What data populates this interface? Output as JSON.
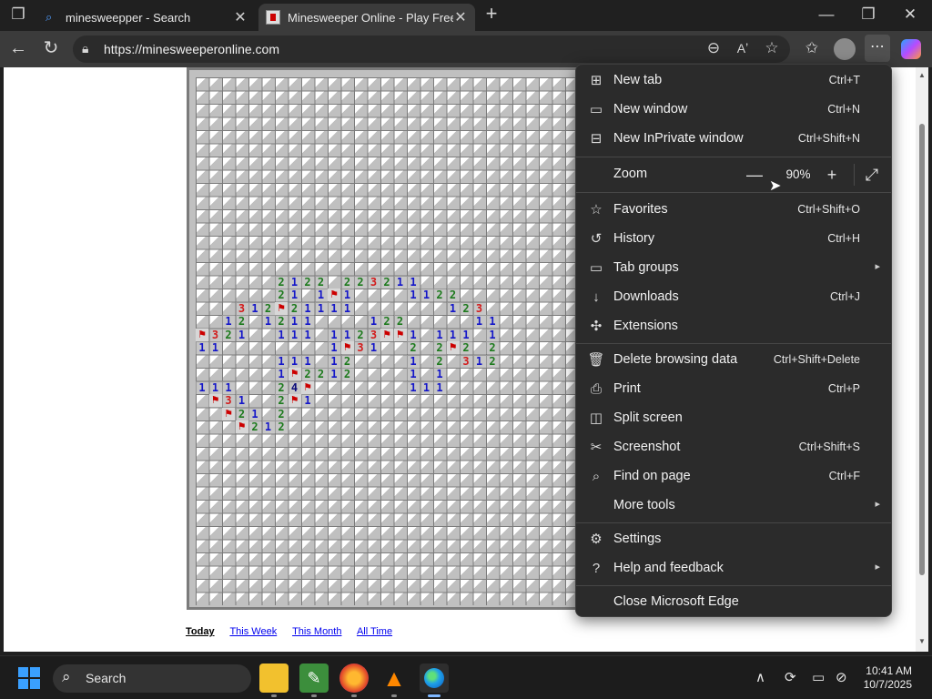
{
  "browser": {
    "tabs": [
      {
        "title": "minesweepper - Search",
        "close": "✕"
      },
      {
        "title": "Minesweeper Online - Play Free Online",
        "close": "✕"
      }
    ],
    "new_tab": "+",
    "window_controls": {
      "minimize": "—",
      "restore": "❐",
      "close": "✕"
    },
    "url": "https://minesweeperonline.com",
    "nav": {
      "back": "←",
      "refresh": "↻"
    }
  },
  "page": {
    "links": [
      {
        "label": "Today"
      },
      {
        "label": "This Week"
      },
      {
        "label": "This Month"
      },
      {
        "label": "All Time"
      }
    ],
    "board": {
      "cols": 29,
      "rows": 40,
      "revealed": [
        [
          6,
          15,
          "2"
        ],
        [
          7,
          15,
          "1"
        ],
        [
          8,
          15,
          "2"
        ],
        [
          9,
          15,
          "2"
        ],
        [
          11,
          15,
          "2"
        ],
        [
          12,
          15,
          "2"
        ],
        [
          13,
          15,
          "3"
        ],
        [
          14,
          15,
          "2"
        ],
        [
          15,
          15,
          "1"
        ],
        [
          16,
          15,
          "1"
        ],
        [
          6,
          16,
          "2"
        ],
        [
          7,
          16,
          "1"
        ],
        [
          9,
          16,
          "1"
        ],
        [
          10,
          16,
          "F"
        ],
        [
          11,
          16,
          "1"
        ],
        [
          16,
          16,
          "1"
        ],
        [
          17,
          16,
          "1"
        ],
        [
          18,
          16,
          "2"
        ],
        [
          19,
          16,
          "2"
        ],
        [
          3,
          17,
          "3"
        ],
        [
          4,
          17,
          "1"
        ],
        [
          5,
          17,
          "2"
        ],
        [
          6,
          17,
          "F"
        ],
        [
          7,
          17,
          "2"
        ],
        [
          8,
          17,
          "1"
        ],
        [
          9,
          17,
          "1"
        ],
        [
          10,
          17,
          "1"
        ],
        [
          11,
          17,
          "1"
        ],
        [
          19,
          17,
          "1"
        ],
        [
          20,
          17,
          "2"
        ],
        [
          21,
          17,
          "3"
        ],
        [
          2,
          18,
          "1"
        ],
        [
          3,
          18,
          "2"
        ],
        [
          5,
          18,
          "1"
        ],
        [
          6,
          18,
          "2"
        ],
        [
          7,
          18,
          "1"
        ],
        [
          8,
          18,
          "1"
        ],
        [
          13,
          18,
          "1"
        ],
        [
          14,
          18,
          "2"
        ],
        [
          15,
          18,
          "2"
        ],
        [
          21,
          18,
          "1"
        ],
        [
          22,
          18,
          "1"
        ],
        [
          0,
          19,
          "F"
        ],
        [
          1,
          19,
          "3"
        ],
        [
          2,
          19,
          "2"
        ],
        [
          3,
          19,
          "1"
        ],
        [
          6,
          19,
          "1"
        ],
        [
          7,
          19,
          "1"
        ],
        [
          8,
          19,
          "1"
        ],
        [
          10,
          19,
          "1"
        ],
        [
          11,
          19,
          "1"
        ],
        [
          12,
          19,
          "2"
        ],
        [
          13,
          19,
          "3"
        ],
        [
          14,
          19,
          "F"
        ],
        [
          15,
          19,
          "F"
        ],
        [
          16,
          19,
          "1"
        ],
        [
          18,
          19,
          "1"
        ],
        [
          19,
          19,
          "1"
        ],
        [
          20,
          19,
          "1"
        ],
        [
          22,
          19,
          "1"
        ],
        [
          0,
          20,
          "1"
        ],
        [
          1,
          20,
          "1"
        ],
        [
          10,
          20,
          "1"
        ],
        [
          11,
          20,
          "F"
        ],
        [
          12,
          20,
          "3"
        ],
        [
          13,
          20,
          "1"
        ],
        [
          16,
          20,
          "2"
        ],
        [
          18,
          20,
          "2"
        ],
        [
          19,
          20,
          "F"
        ],
        [
          20,
          20,
          "2"
        ],
        [
          22,
          20,
          "2"
        ],
        [
          6,
          21,
          "1"
        ],
        [
          7,
          21,
          "1"
        ],
        [
          8,
          21,
          "1"
        ],
        [
          10,
          21,
          "1"
        ],
        [
          11,
          21,
          "2"
        ],
        [
          16,
          21,
          "1"
        ],
        [
          18,
          21,
          "2"
        ],
        [
          20,
          21,
          "3"
        ],
        [
          21,
          21,
          "1"
        ],
        [
          22,
          21,
          "2"
        ],
        [
          6,
          22,
          "1"
        ],
        [
          7,
          22,
          "F"
        ],
        [
          8,
          22,
          "2"
        ],
        [
          9,
          22,
          "2"
        ],
        [
          10,
          22,
          "1"
        ],
        [
          11,
          22,
          "2"
        ],
        [
          16,
          22,
          "1"
        ],
        [
          18,
          22,
          "1"
        ],
        [
          0,
          23,
          "1"
        ],
        [
          1,
          23,
          "1"
        ],
        [
          2,
          23,
          "1"
        ],
        [
          6,
          23,
          "2"
        ],
        [
          7,
          23,
          "4"
        ],
        [
          8,
          23,
          "F"
        ],
        [
          16,
          23,
          "1"
        ],
        [
          17,
          23,
          "1"
        ],
        [
          18,
          23,
          "1"
        ],
        [
          1,
          24,
          "F"
        ],
        [
          2,
          24,
          "3"
        ],
        [
          3,
          24,
          "1"
        ],
        [
          6,
          24,
          "2"
        ],
        [
          7,
          24,
          "F"
        ],
        [
          8,
          24,
          "1"
        ],
        [
          2,
          25,
          "F"
        ],
        [
          3,
          25,
          "2"
        ],
        [
          4,
          25,
          "1"
        ],
        [
          6,
          25,
          "2"
        ],
        [
          3,
          26,
          "F"
        ],
        [
          4,
          26,
          "2"
        ],
        [
          5,
          26,
          "1"
        ],
        [
          6,
          26,
          "2"
        ]
      ]
    }
  },
  "menu": {
    "items": [
      {
        "key": "new-tab",
        "icon": "new-tab-icon",
        "glyph": "⊞",
        "label": "New tab",
        "shortcut": "Ctrl+T"
      },
      {
        "key": "new-window",
        "icon": "window-icon",
        "glyph": "▭",
        "label": "New window",
        "shortcut": "Ctrl+N"
      },
      {
        "key": "inprivate",
        "icon": "inprivate-icon",
        "glyph": "⊟",
        "label": "New InPrivate window",
        "shortcut": "Ctrl+Shift+N"
      }
    ],
    "zoom": {
      "label": "Zoom",
      "value": "90%",
      "minus": "—",
      "plus": "+",
      "fullscreen": "⤢"
    },
    "items2": [
      {
        "key": "favorites",
        "icon": "star-icon",
        "glyph": "☆",
        "label": "Favorites",
        "shortcut": "Ctrl+Shift+O"
      },
      {
        "key": "history",
        "icon": "history-icon",
        "glyph": "↺",
        "label": "History",
        "shortcut": "Ctrl+H"
      },
      {
        "key": "tab-groups",
        "icon": "tab-groups-icon",
        "glyph": "▭",
        "label": "Tab groups",
        "submenu": "▸"
      },
      {
        "key": "downloads",
        "icon": "download-icon",
        "glyph": "↓",
        "label": "Downloads",
        "shortcut": "Ctrl+J"
      },
      {
        "key": "extensions",
        "icon": "puzzle-icon",
        "glyph": "✣",
        "label": "Extensions"
      }
    ],
    "items3": [
      {
        "key": "delete-browsing-data",
        "icon": "trash-icon",
        "glyph": "🗑",
        "label": "Delete browsing data",
        "shortcut": "Ctrl+Shift+Delete"
      },
      {
        "key": "print",
        "icon": "printer-icon",
        "glyph": "⎙",
        "label": "Print",
        "shortcut": "Ctrl+P"
      },
      {
        "key": "split-screen",
        "icon": "split-screen-icon",
        "glyph": "◫",
        "label": "Split screen"
      },
      {
        "key": "screenshot",
        "icon": "screenshot-icon",
        "glyph": "✂",
        "label": "Screenshot",
        "shortcut": "Ctrl+Shift+S"
      },
      {
        "key": "find-on-page",
        "icon": "find-icon",
        "glyph": "⌕",
        "label": "Find on page",
        "shortcut": "Ctrl+F"
      },
      {
        "key": "more-tools",
        "icon": "",
        "glyph": "",
        "label": "More tools",
        "submenu": "▸"
      }
    ],
    "items4": [
      {
        "key": "settings",
        "icon": "gear-icon",
        "glyph": "⚙",
        "label": "Settings"
      },
      {
        "key": "help",
        "icon": "help-icon",
        "glyph": "?",
        "label": "Help and feedback",
        "submenu": "▸"
      }
    ],
    "close_item": {
      "label": "Close Microsoft Edge"
    }
  },
  "taskbar": {
    "search_label": "Search",
    "time": "10:41 AM",
    "date": "10/7/2025"
  }
}
